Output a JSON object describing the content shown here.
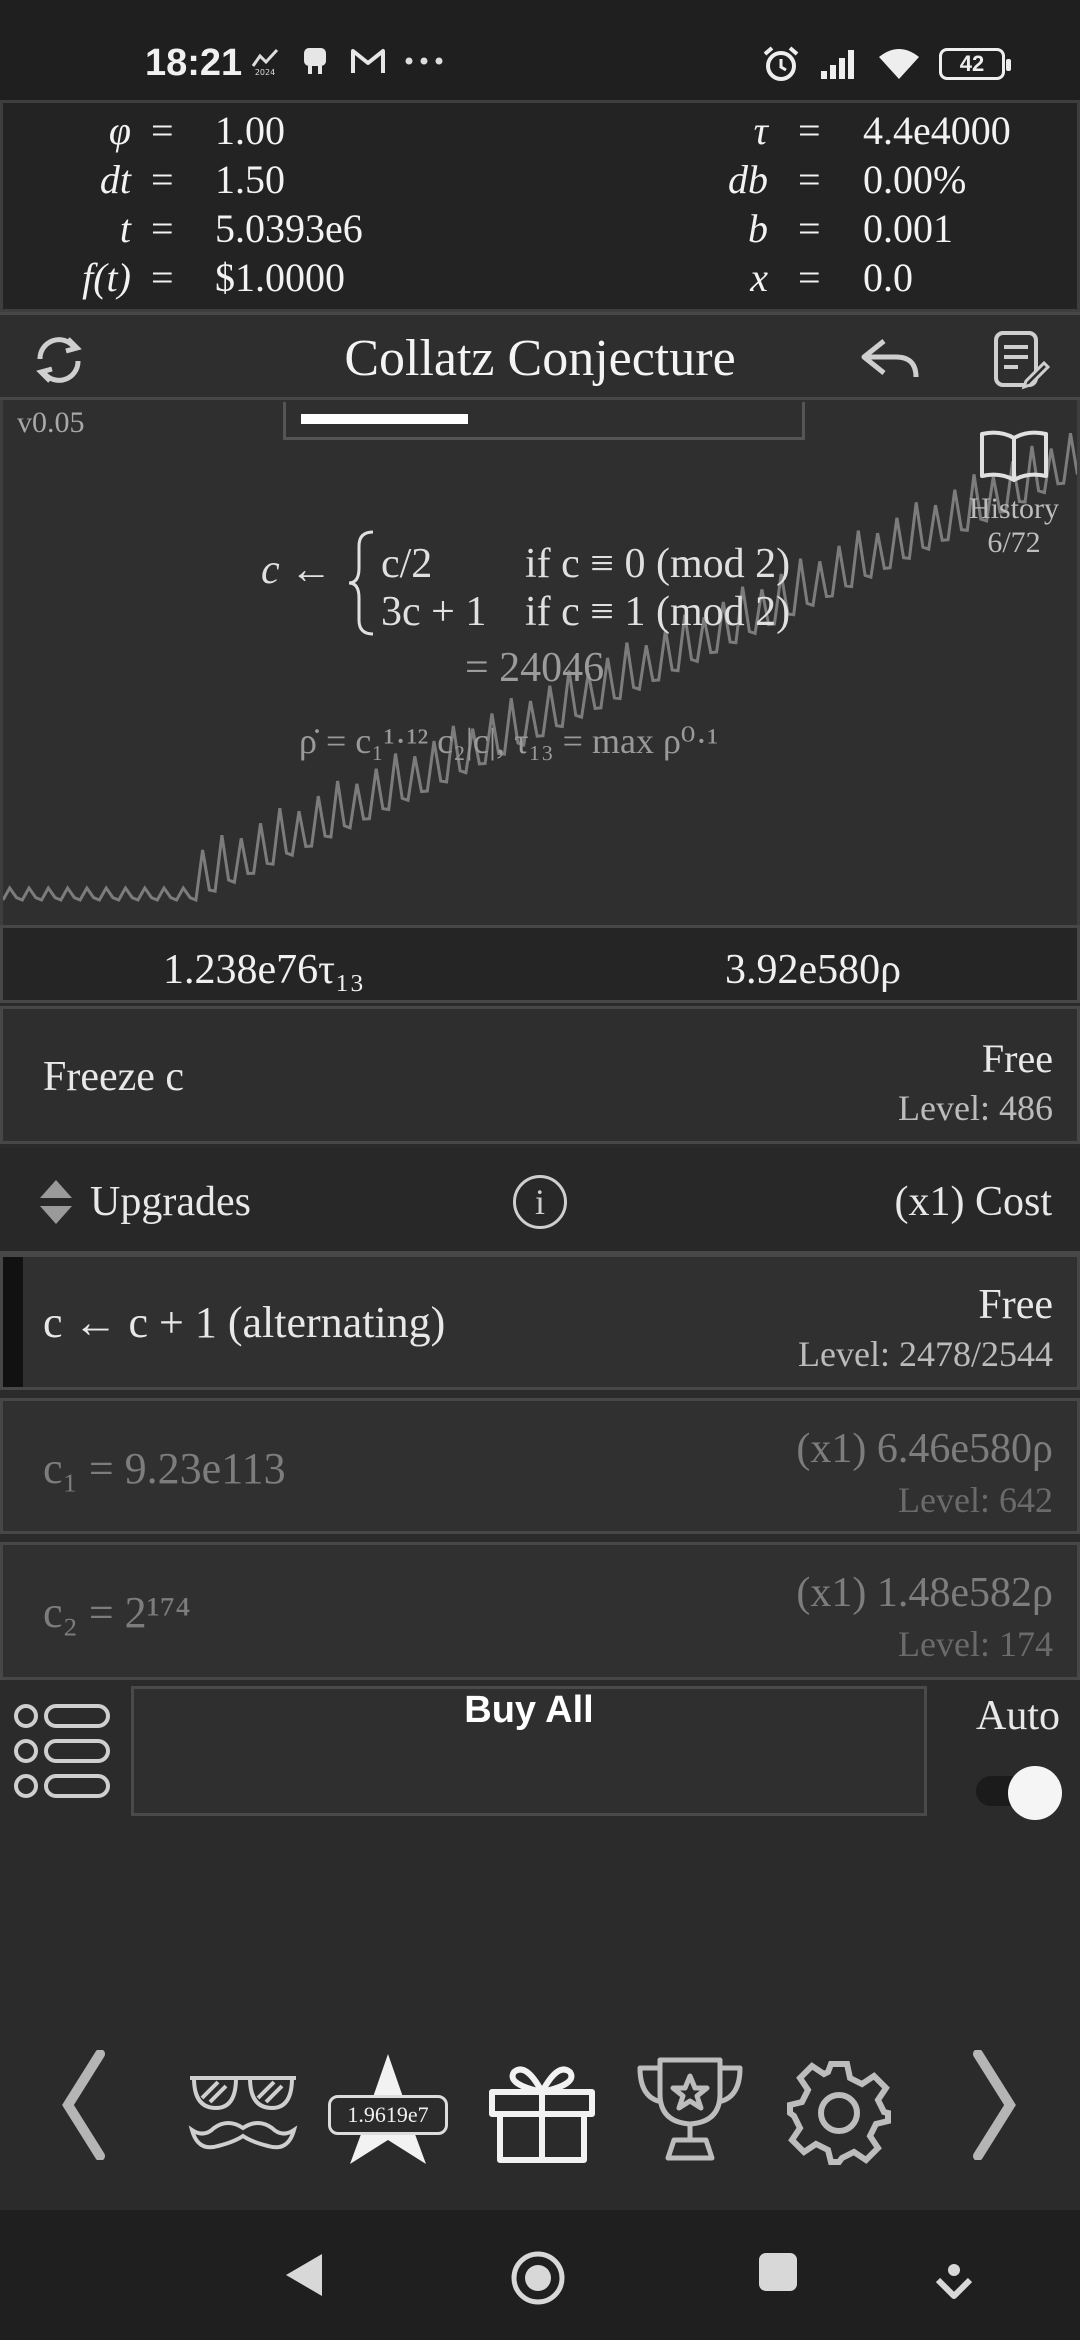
{
  "status_bar": {
    "time": "18:21",
    "battery": "42"
  },
  "variables": {
    "left": [
      {
        "symbol": "φ",
        "value": "1.00"
      },
      {
        "symbol": "dt",
        "value": "1.50"
      },
      {
        "symbol": "t",
        "value": "5.0393e6"
      },
      {
        "symbol": "f(t)",
        "value": "$1.0000"
      }
    ],
    "right": [
      {
        "symbol": "τ",
        "value": "4.4e4000"
      },
      {
        "symbol": "db",
        "value": "0.00%"
      },
      {
        "symbol": "b",
        "value": "0.001"
      },
      {
        "symbol": "x",
        "value": "0.0"
      }
    ],
    "equals": "="
  },
  "header": {
    "title": "Collatz Conjecture"
  },
  "graph": {
    "version": "v0.05",
    "progress_fraction": 0.34,
    "history_label": "History",
    "history_count": "6/72",
    "formula_lhs": "c ←",
    "case1_expr": "c/2",
    "case1_cond": "if c ≡ 0 (mod 2)",
    "case2_expr": "3c + 1",
    "case2_cond": "if c ≡ 1 (mod 2)",
    "result": "= 24046",
    "rho_formula": "ρ̇ = c₁¹·¹² c₂|c|,   τ₁₃ = max ρ⁰·¹"
  },
  "currencies": {
    "tau": "1.238e76τ₁₃",
    "rho": "3.92e580ρ"
  },
  "freeze": {
    "label": "Freeze c",
    "price": "Free",
    "level": "Level: 486"
  },
  "upgrades_header": {
    "label": "Upgrades",
    "info": "i",
    "cost": "(x1) Cost"
  },
  "upgrades": [
    {
      "label": "c ← c + 1 (alternating)",
      "price": "Free",
      "level": "Level: 2478/2544"
    },
    {
      "label": "c₁ = 9.23e113",
      "price": "(x1) 6.46e580ρ",
      "level": "Level: 642"
    },
    {
      "label": "c₂ = 2¹⁷⁴",
      "price": "(x1) 1.48e582ρ",
      "level": "Level: 174"
    }
  ],
  "buy": {
    "buy_all": "Buy All",
    "auto_label": "Auto",
    "auto_on": true
  },
  "bottom_nav": {
    "star_badge": "1.9619e7",
    "icons": [
      "chevron-left-icon",
      "glasses-mustache-icon",
      "star-icon",
      "gift-icon",
      "trophy-icon",
      "gear-icon",
      "chevron-right-icon"
    ]
  }
}
